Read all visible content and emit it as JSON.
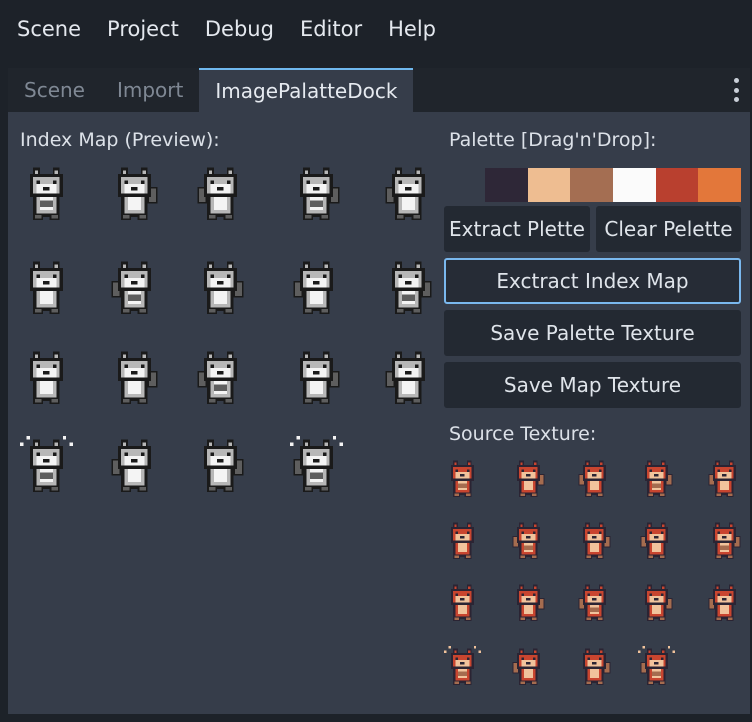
{
  "menubar": {
    "items": [
      "Scene",
      "Project",
      "Debug",
      "Editor",
      "Help"
    ]
  },
  "tabs": [
    {
      "label": "Scene",
      "active": false
    },
    {
      "label": "Import",
      "active": false
    },
    {
      "label": "ImagePalatteDock",
      "active": true
    }
  ],
  "dock": {
    "index_map_label": "Index Map (Preview):",
    "palette_label": "Palette  [Drag'n'Drop]:",
    "palette_colors": [
      "#2e2737",
      "#eebd91",
      "#a46e52",
      "#fbfbfb",
      "#b9402f",
      "#e3773a"
    ],
    "buttons": {
      "extract_palette": "Extract Plette",
      "clear_palette": "Clear Pelette",
      "extract_index_map": "Exctract Index Map",
      "save_palette_texture": "Save Palette Texture",
      "save_map_texture": "Save Map Texture"
    },
    "source_texture_label": "Source Texture:",
    "index_colors": {
      "light": "#f4f4f4",
      "mid": "#b7b7b7",
      "dark": "#5e5e5e",
      "outline": "#1a1a1a"
    },
    "source_colors": {
      "body": "#c9452f",
      "light": "#f1c39c",
      "dark": "#a56c4f",
      "white": "#ffffff",
      "outline": "#2b2433",
      "accent": "#e4783a"
    }
  }
}
